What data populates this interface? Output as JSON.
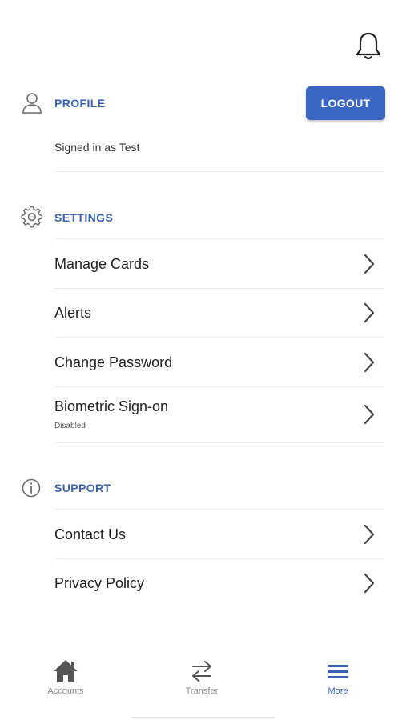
{
  "profile": {
    "title": "PROFILE",
    "signed_in": "Signed in as Test",
    "logout_label": "LOGOUT"
  },
  "settings": {
    "title": "SETTINGS",
    "items": [
      {
        "label": "Manage Cards"
      },
      {
        "label": "Alerts"
      },
      {
        "label": "Change Password"
      },
      {
        "label": "Biometric Sign-on",
        "sub": "Disabled"
      }
    ]
  },
  "support": {
    "title": "SUPPORT",
    "items": [
      {
        "label": "Contact Us"
      },
      {
        "label": "Privacy Policy"
      }
    ]
  },
  "tabbar": {
    "tabs": [
      {
        "label": "Accounts",
        "icon": "home-icon"
      },
      {
        "label": "Transfer",
        "icon": "transfer-icon"
      },
      {
        "label": "More",
        "icon": "menu-icon",
        "active": true
      }
    ]
  },
  "colors": {
    "accent": "#3a63b6",
    "button": "#3a66c4",
    "icon_gray": "#6b6b6b"
  }
}
